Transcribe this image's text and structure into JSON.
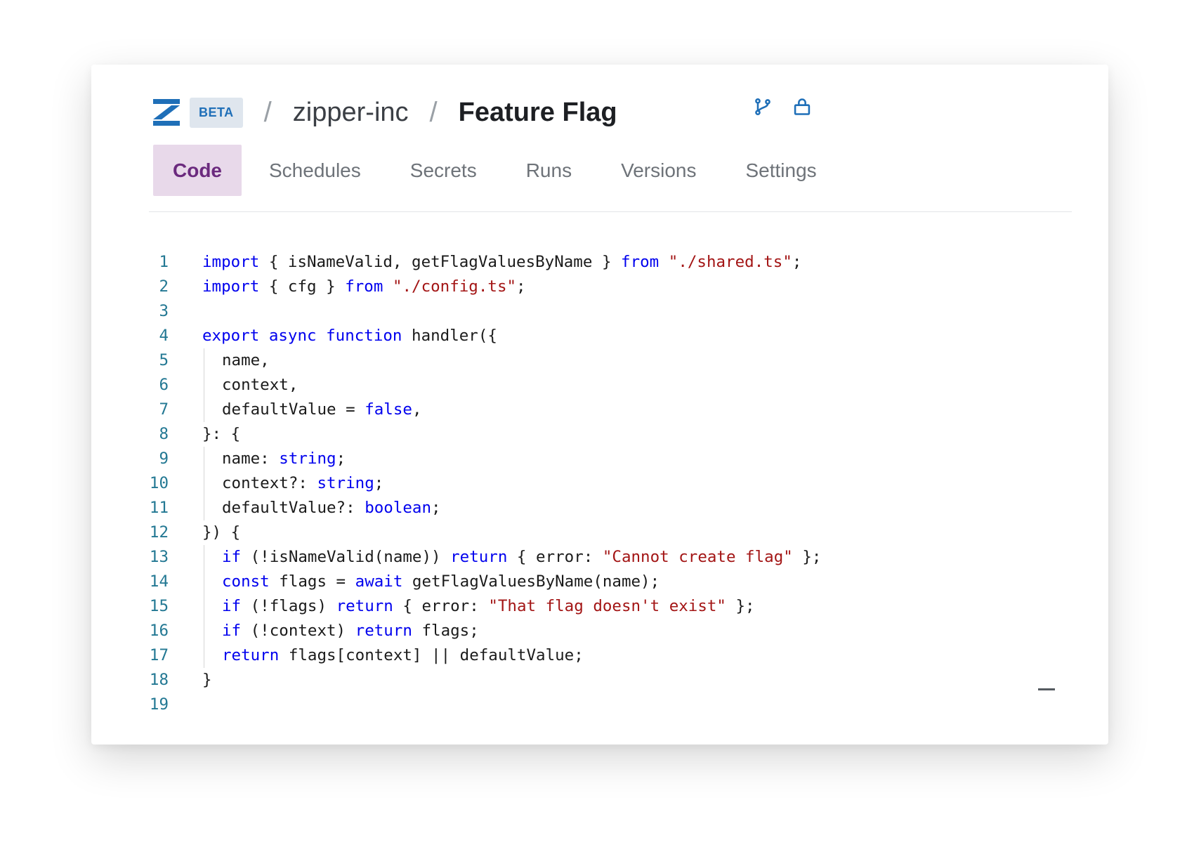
{
  "header": {
    "beta_label": "BETA",
    "separator": "/",
    "org": "zipper-inc",
    "app_title": "Feature Flag"
  },
  "tabs": [
    {
      "label": "Code",
      "active": true
    },
    {
      "label": "Schedules",
      "active": false
    },
    {
      "label": "Secrets",
      "active": false
    },
    {
      "label": "Runs",
      "active": false
    },
    {
      "label": "Versions",
      "active": false
    },
    {
      "label": "Settings",
      "active": false
    }
  ],
  "icons": {
    "branch": "git-branch-icon",
    "lock": "lock-icon",
    "logo": "zipper-logo-icon",
    "minimize": "minimize-icon"
  },
  "colors": {
    "brand_blue": "#1f6fb8",
    "active_tab_bg": "#e8d9ea",
    "active_tab_text": "#6b2a7e",
    "keyword": "#0000ee",
    "string": "#a31515",
    "line_number": "#237893"
  },
  "code": {
    "lines": [
      {
        "n": "1",
        "indent": 0,
        "tokens": [
          {
            "t": "import",
            "c": "kw"
          },
          {
            "t": " { isNameValid, getFlagValuesByName } "
          },
          {
            "t": "from",
            "c": "kw"
          },
          {
            "t": " "
          },
          {
            "t": "\"./shared.ts\"",
            "c": "str"
          },
          {
            "t": ";"
          }
        ]
      },
      {
        "n": "2",
        "indent": 0,
        "tokens": [
          {
            "t": "import",
            "c": "kw"
          },
          {
            "t": " { cfg } "
          },
          {
            "t": "from",
            "c": "kw"
          },
          {
            "t": " "
          },
          {
            "t": "\"./config.ts\"",
            "c": "str"
          },
          {
            "t": ";"
          }
        ]
      },
      {
        "n": "3",
        "indent": 0,
        "tokens": []
      },
      {
        "n": "4",
        "indent": 0,
        "tokens": [
          {
            "t": "export",
            "c": "kw"
          },
          {
            "t": " "
          },
          {
            "t": "async",
            "c": "kw"
          },
          {
            "t": " "
          },
          {
            "t": "function",
            "c": "kw"
          },
          {
            "t": " handler({"
          }
        ]
      },
      {
        "n": "5",
        "indent": 1,
        "tokens": [
          {
            "t": "name,"
          }
        ]
      },
      {
        "n": "6",
        "indent": 1,
        "tokens": [
          {
            "t": "context,"
          }
        ]
      },
      {
        "n": "7",
        "indent": 1,
        "tokens": [
          {
            "t": "defaultValue = "
          },
          {
            "t": "false",
            "c": "kw"
          },
          {
            "t": ","
          }
        ]
      },
      {
        "n": "8",
        "indent": 0,
        "tokens": [
          {
            "t": "}: {"
          }
        ]
      },
      {
        "n": "9",
        "indent": 1,
        "tokens": [
          {
            "t": "name: "
          },
          {
            "t": "string",
            "c": "kw"
          },
          {
            "t": ";"
          }
        ]
      },
      {
        "n": "10",
        "indent": 1,
        "tokens": [
          {
            "t": "context?: "
          },
          {
            "t": "string",
            "c": "kw"
          },
          {
            "t": ";"
          }
        ]
      },
      {
        "n": "11",
        "indent": 1,
        "tokens": [
          {
            "t": "defaultValue?: "
          },
          {
            "t": "boolean",
            "c": "kw"
          },
          {
            "t": ";"
          }
        ]
      },
      {
        "n": "12",
        "indent": 0,
        "tokens": [
          {
            "t": "}) {"
          }
        ]
      },
      {
        "n": "13",
        "indent": 1,
        "tokens": [
          {
            "t": "if",
            "c": "kw"
          },
          {
            "t": " (!isNameValid(name)) "
          },
          {
            "t": "return",
            "c": "kw"
          },
          {
            "t": " { error: "
          },
          {
            "t": "\"Cannot create flag\"",
            "c": "str"
          },
          {
            "t": " };"
          }
        ]
      },
      {
        "n": "14",
        "indent": 1,
        "tokens": [
          {
            "t": "const",
            "c": "kw"
          },
          {
            "t": " flags = "
          },
          {
            "t": "await",
            "c": "kw"
          },
          {
            "t": " getFlagValuesByName(name);"
          }
        ]
      },
      {
        "n": "15",
        "indent": 1,
        "tokens": [
          {
            "t": "if",
            "c": "kw"
          },
          {
            "t": " (!flags) "
          },
          {
            "t": "return",
            "c": "kw"
          },
          {
            "t": " { error: "
          },
          {
            "t": "\"That flag doesn't exist\"",
            "c": "str"
          },
          {
            "t": " };"
          }
        ]
      },
      {
        "n": "16",
        "indent": 1,
        "tokens": [
          {
            "t": "if",
            "c": "kw"
          },
          {
            "t": " (!context) "
          },
          {
            "t": "return",
            "c": "kw"
          },
          {
            "t": " flags;"
          }
        ]
      },
      {
        "n": "17",
        "indent": 1,
        "tokens": [
          {
            "t": "return",
            "c": "kw"
          },
          {
            "t": " flags[context] || defaultValue;"
          }
        ]
      },
      {
        "n": "18",
        "indent": 0,
        "tokens": [
          {
            "t": "}"
          }
        ]
      },
      {
        "n": "19",
        "indent": 0,
        "tokens": []
      }
    ]
  }
}
